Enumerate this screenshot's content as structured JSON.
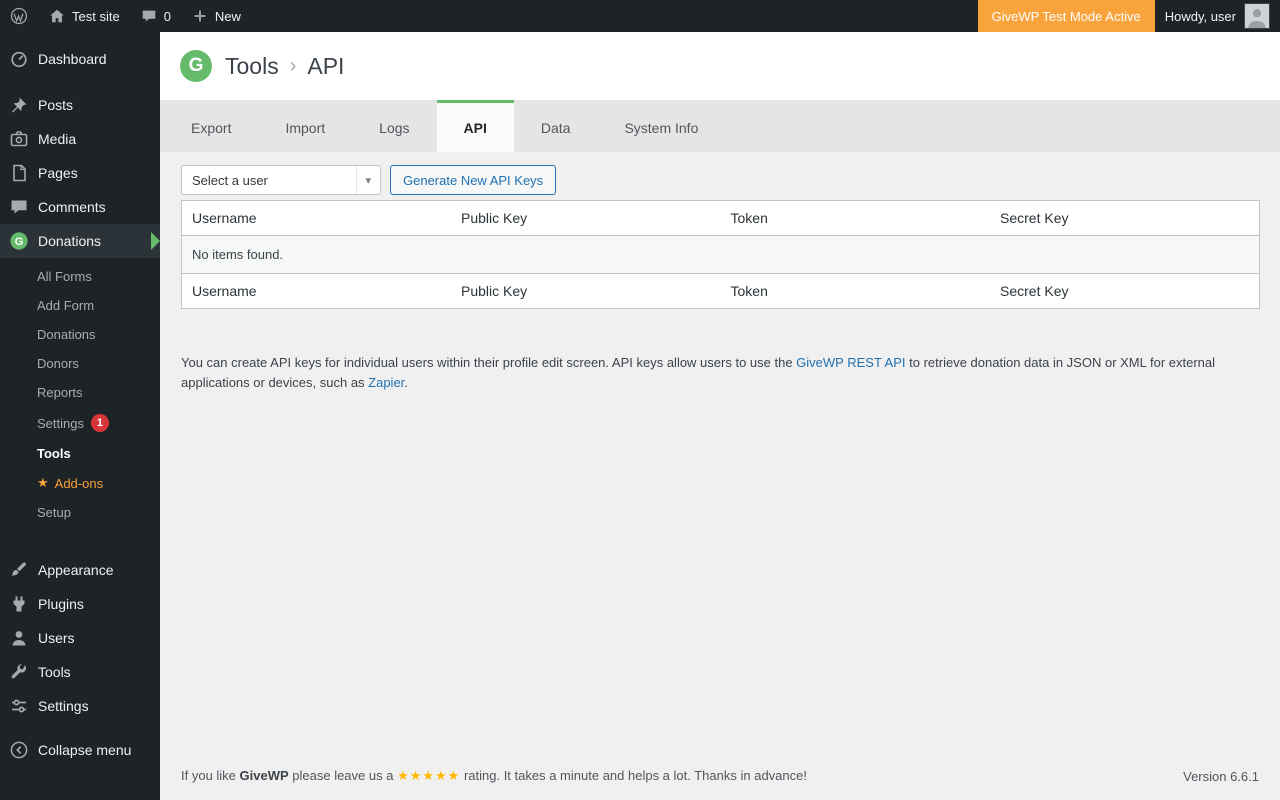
{
  "colors": {
    "accent_green": "#66bb6a",
    "admin_dark": "#1d2327",
    "test_mode_orange": "#f8a33c",
    "badge_red": "#d63638",
    "link_blue": "#2271b1",
    "addons_orange": "#f9a13a",
    "star_gold": "#ffb900"
  },
  "icons": {
    "chevron_down": "▾"
  },
  "admin_bar": {
    "site_name": "Test site",
    "comment_count": "0",
    "new_label": "New",
    "test_mode": "GiveWP Test Mode Active",
    "greeting": "Howdy, user"
  },
  "sidebar": {
    "top_items": [
      {
        "label": "Dashboard"
      },
      {
        "label": "Posts"
      },
      {
        "label": "Media"
      },
      {
        "label": "Pages"
      },
      {
        "label": "Comments"
      },
      {
        "label": "Donations"
      }
    ],
    "donations_submenu": [
      {
        "label": "All Forms"
      },
      {
        "label": "Add Form"
      },
      {
        "label": "Donations"
      },
      {
        "label": "Donors"
      },
      {
        "label": "Reports"
      },
      {
        "label": "Settings",
        "badge": "1"
      },
      {
        "label": "Tools"
      },
      {
        "label": "Add-ons",
        "star": "★"
      },
      {
        "label": "Setup"
      }
    ],
    "bottom_items": [
      {
        "label": "Appearance"
      },
      {
        "label": "Plugins"
      },
      {
        "label": "Users"
      },
      {
        "label": "Tools"
      },
      {
        "label": "Settings"
      }
    ],
    "collapse_label": "Collapse menu"
  },
  "header": {
    "logo_letter": "G",
    "breadcrumb": {
      "parent": "Tools",
      "separator": "›",
      "current": "API"
    }
  },
  "tabs": [
    {
      "label": "Export"
    },
    {
      "label": "Import"
    },
    {
      "label": "Logs"
    },
    {
      "label": "API"
    },
    {
      "label": "Data"
    },
    {
      "label": "System Info"
    }
  ],
  "api": {
    "user_select_value": "Select a user",
    "generate_button": "Generate New API Keys",
    "table": {
      "headers": [
        "Username",
        "Public Key",
        "Token",
        "Secret Key"
      ],
      "empty": "No items found."
    },
    "description": {
      "part1": "You can create API keys for individual users within their profile edit screen. API keys allow users to use the ",
      "link1": "GiveWP REST API",
      "part2": " to retrieve donation data in JSON or XML for external applications or devices, such as ",
      "link2": "Zapier",
      "part3": "."
    }
  },
  "footer": {
    "like_prefix": "If you like ",
    "brand": "GiveWP",
    "like_mid": " please leave us a ",
    "stars": "★★★★★",
    "like_suffix": " rating. It takes a minute and helps a lot. Thanks in advance!",
    "version": "Version 6.6.1"
  }
}
